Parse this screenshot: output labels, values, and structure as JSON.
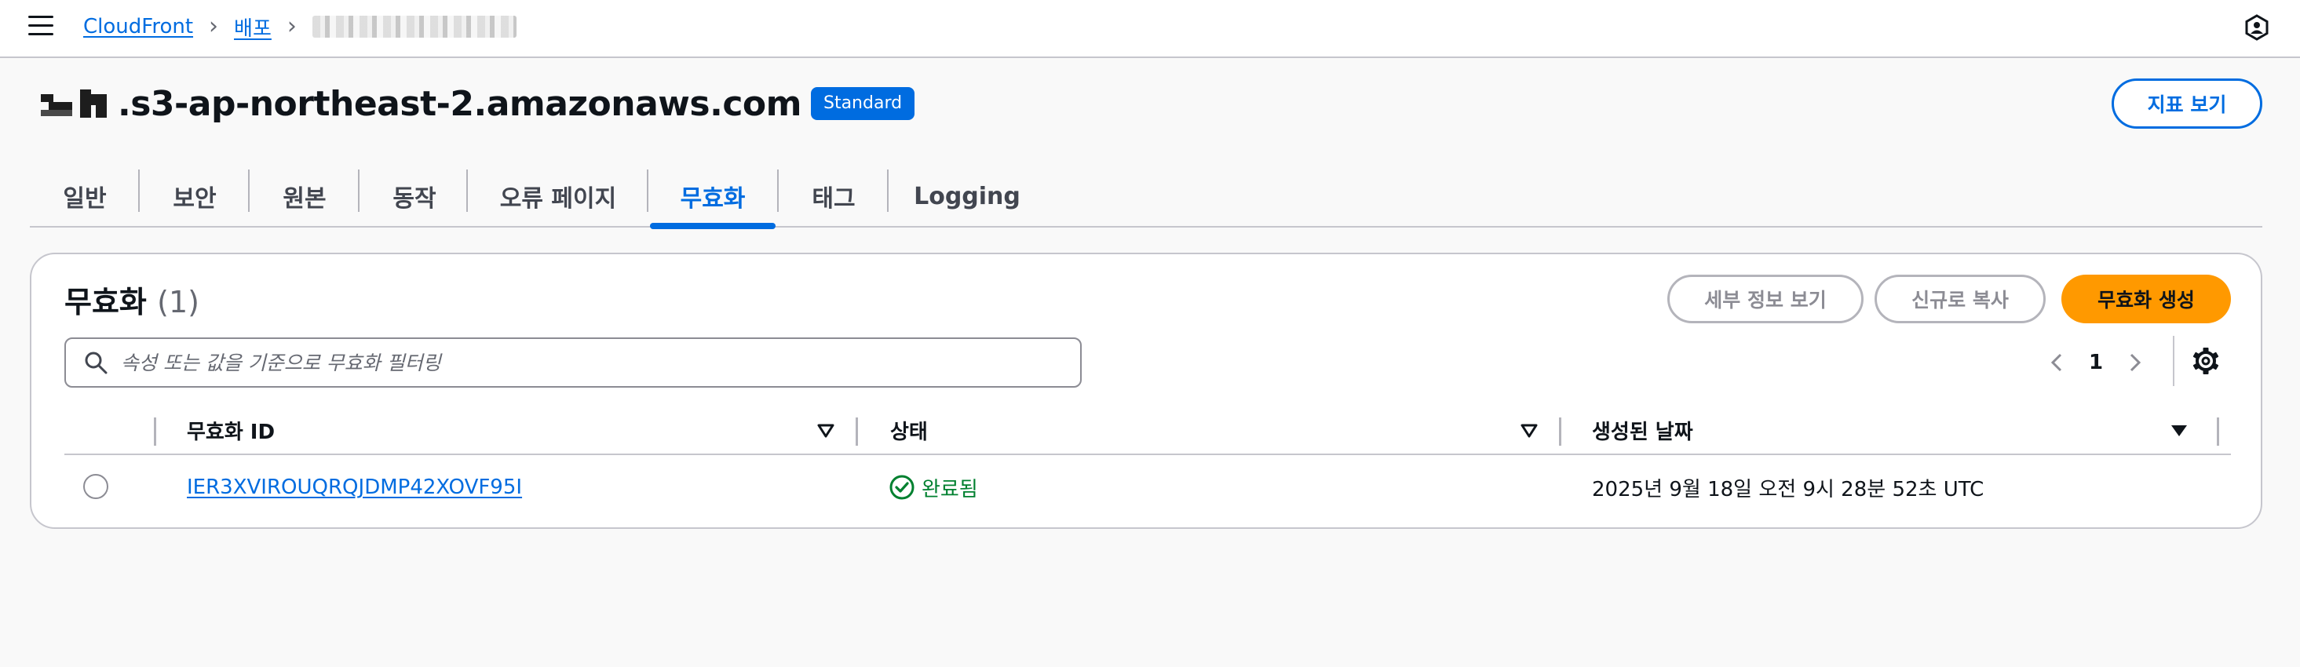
{
  "topbar": {
    "menu_icon": "hamburger-menu-icon",
    "breadcrumbs": [
      {
        "label": "CloudFront"
      },
      {
        "label": "배포"
      }
    ],
    "profile_icon": "user-profile-icon"
  },
  "header": {
    "title": ".s3-ap-northeast-2.amazonaws.com",
    "badge": "Standard",
    "metrics_button": "지표 보기"
  },
  "tabs": [
    {
      "label": "일반"
    },
    {
      "label": "보안"
    },
    {
      "label": "원본"
    },
    {
      "label": "동작"
    },
    {
      "label": "오류 페이지"
    },
    {
      "label": "무효화",
      "active": true
    },
    {
      "label": "태그"
    },
    {
      "label": "Logging"
    }
  ],
  "invalidations": {
    "title": "무효화",
    "count": "(1)",
    "buttons": {
      "details": "세부 정보 보기",
      "copy": "신규로 복사",
      "create": "무효화 생성"
    },
    "search": {
      "placeholder": "속성 또는 값을 기준으로 무효화 필터링",
      "value": ""
    },
    "pagination": {
      "current_page": "1"
    },
    "columns": [
      "무효화 ID",
      "상태",
      "생성된 날짜"
    ],
    "rows": [
      {
        "id": "IER3XVIROUQRQJDMP42XOVF95I",
        "status": "완료됨",
        "created": "2025년 9월 18일 오전 9시 28분 52초 UTC",
        "selected": false
      }
    ]
  },
  "colors": {
    "accent": "#006ce0",
    "primary_button": "#ff9900",
    "success": "#00802f",
    "border": "#c6c6cd"
  }
}
